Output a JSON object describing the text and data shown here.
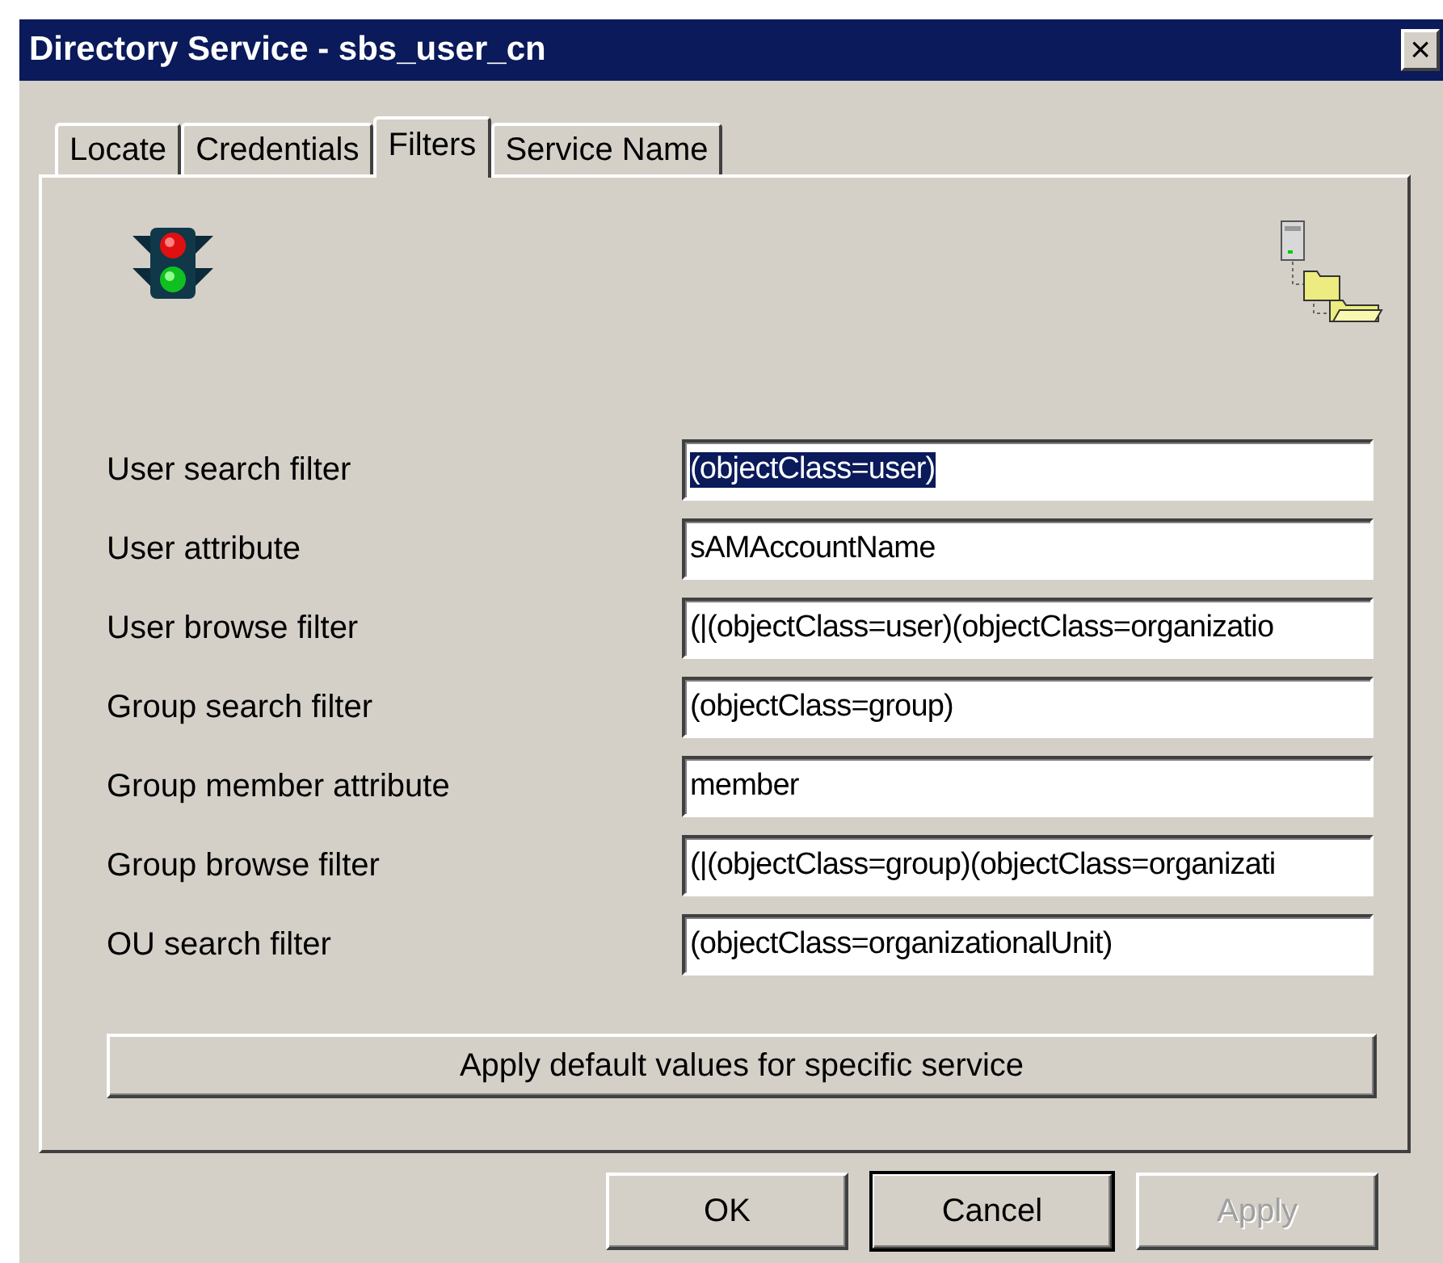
{
  "window": {
    "title": "Directory Service - sbs_user_cn",
    "close": "×"
  },
  "tabs": [
    {
      "label": "Locate",
      "selected": false
    },
    {
      "label": "Credentials",
      "selected": false
    },
    {
      "label": "Filters",
      "selected": true
    },
    {
      "label": "Service Name",
      "selected": false
    }
  ],
  "fields": [
    {
      "label": "User search filter",
      "value": "(objectClass=user)",
      "text_selected": true
    },
    {
      "label": "User attribute",
      "value": "sAMAccountName",
      "text_selected": false
    },
    {
      "label": "User browse filter",
      "value": "(|(objectClass=user)(objectClass=organizatio",
      "text_selected": false
    },
    {
      "label": "Group search filter",
      "value": "(objectClass=group)",
      "text_selected": false
    },
    {
      "label": "Group member attribute",
      "value": "member",
      "text_selected": false
    },
    {
      "label": "Group browse filter",
      "value": "(|(objectClass=group)(objectClass=organizati",
      "text_selected": false
    },
    {
      "label": "OU search filter",
      "value": "(objectClass=organizationalUnit)",
      "text_selected": false
    }
  ],
  "apply_defaults_button": "Apply default values for specific service",
  "buttons": [
    {
      "label": "OK",
      "default": false,
      "disabled": false
    },
    {
      "label": "Cancel",
      "default": true,
      "disabled": false
    },
    {
      "label": "Apply",
      "default": false,
      "disabled": true
    }
  ]
}
